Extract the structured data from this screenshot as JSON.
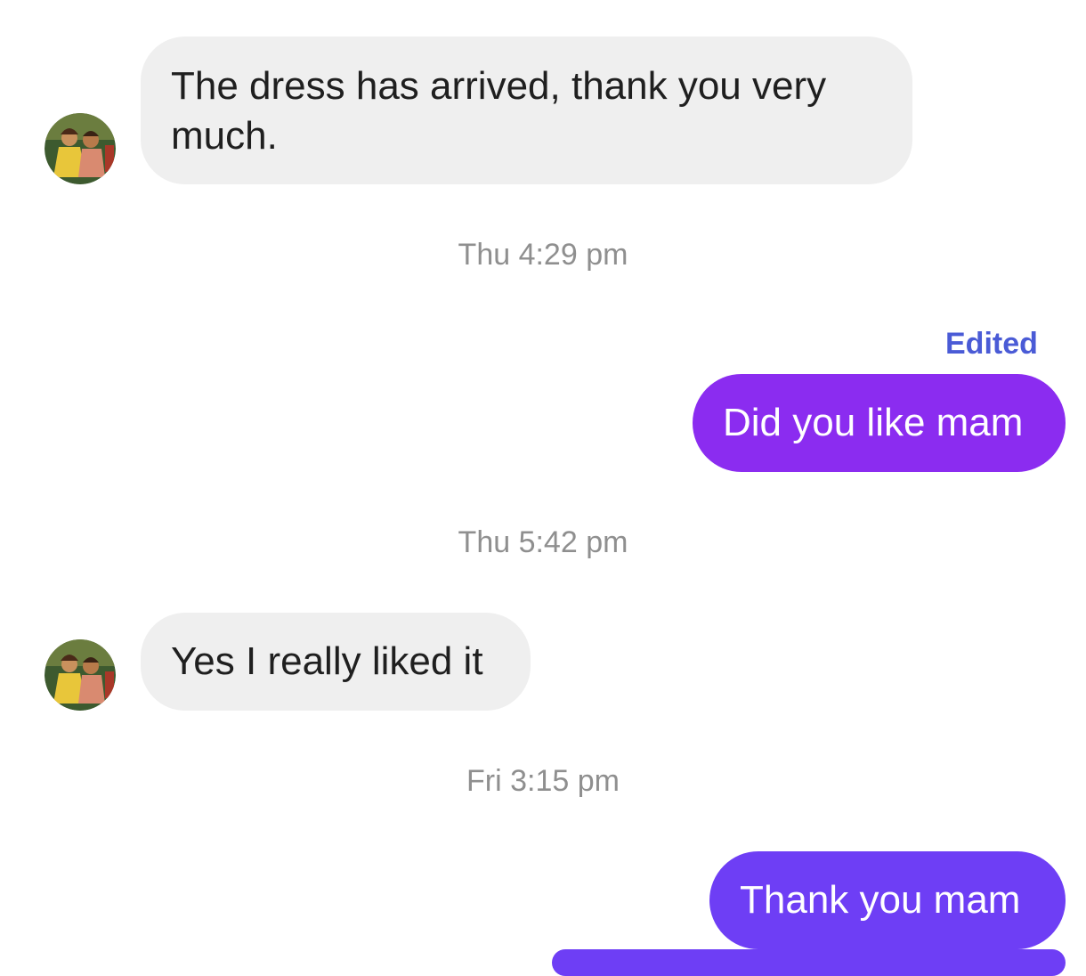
{
  "messages": [
    {
      "sender": "them",
      "text": "The dress has arrived, thank you very much."
    },
    {
      "sender": "me",
      "text": "Did you like mam",
      "edited_label": "Edited"
    },
    {
      "sender": "them",
      "text": "Yes I really liked it"
    },
    {
      "sender": "me",
      "text": "Thank you mam"
    }
  ],
  "timestamps": [
    "Thu 4:29 pm",
    "Thu 5:42 pm",
    "Fri 3:15 pm"
  ],
  "colors": {
    "incoming_bubble": "#efefef",
    "outgoing_bubble_1": "#8b2cf0",
    "outgoing_bubble_2": "#6e3ef5",
    "timestamp_text": "#8f8f8f",
    "edited_text": "#4a5bd6"
  },
  "icons": {
    "avatar": "contact-avatar-icon"
  }
}
